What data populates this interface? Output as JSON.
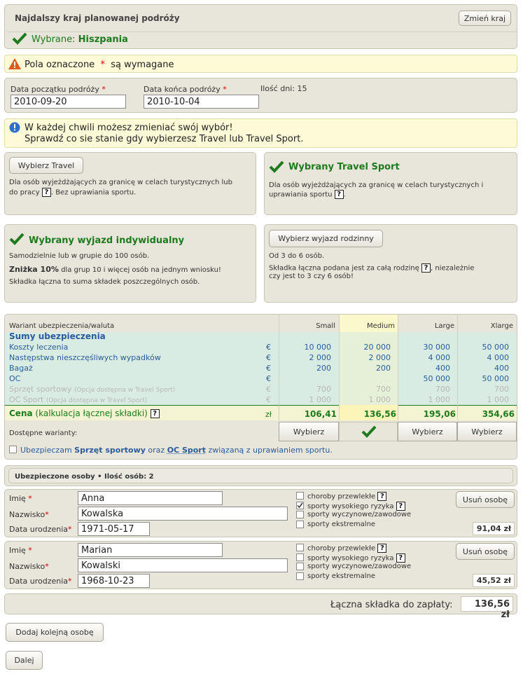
{
  "country": {
    "title": "Najdalszy kraj planowanej podróży",
    "change_button": "Zmień kraj",
    "selected_label": "Wybrane:",
    "selected_value": "Hiszpania"
  },
  "required_notice": {
    "before": "Pola oznaczone",
    "star": "*",
    "after": "są wymagane"
  },
  "dates": {
    "start_label": "Data początku podróży",
    "start_value": "2010-09-20",
    "end_label": "Data końca podróży",
    "end_value": "2010-10-04",
    "days": "Ilość dni: 15"
  },
  "info": {
    "line1": "W każdej chwili możesz zmieniać swój wybór!",
    "line2": "Sprawdź co sie stanie gdy wybierzesz Travel lub Travel Sport."
  },
  "product_travel": {
    "button": "Wybierz Travel",
    "desc1": "Dla osób wyjeżdżających za granicę w celach turystycznych lub",
    "desc2a": "do pracy",
    "help": "?",
    "desc2b": ". Bez uprawiania sportu."
  },
  "product_sport": {
    "title": "Wybrany Travel Sport",
    "desc1": "Dla osób wyjeżdżających za granicę w celach turystycznych i",
    "desc2a": "uprawiania sportu",
    "help": "?",
    "desc2b": "."
  },
  "trip_individual": {
    "title": "Wybrany wyjazd indywidualny",
    "line1": "Samodzielnie lub w grupie do 100 osób.",
    "line2_bold": "Zniżka 10%",
    "line2_rest": "dla grup 10 i więcej osób na jednym wniosku!",
    "line3": "Składka łączna to suma składek poszczególnych osób."
  },
  "trip_family": {
    "button": "Wybierz wyjazd rodzinny",
    "line1": "Od 3 do 6 osób.",
    "line2a": "Składka łączna podana jest za całą rodzinę",
    "help": "?",
    "line2b": ", niezależnie",
    "line3": "czy jest to 3 czy 6 osób!"
  },
  "variants": {
    "header_label": "Wariant ubezpieczenia/waluta",
    "columns": [
      "Small",
      "Medium",
      "Large",
      "Xlarge"
    ],
    "sums_title": "Sumy ubezpieczenia",
    "rows": [
      {
        "label": "Koszty leczenia",
        "note": "",
        "currency": "€",
        "values": [
          "10 000",
          "20 000",
          "30 000",
          "50 000"
        ],
        "style": "blue"
      },
      {
        "label": "Następstwa nieszczęśliwych wypadków",
        "note": "",
        "currency": "€",
        "values": [
          "2 000",
          "2 000",
          "4 000",
          "4 000"
        ],
        "style": "blue"
      },
      {
        "label": "Bagaż",
        "note": "",
        "currency": "€",
        "values": [
          "200",
          "200",
          "400",
          "400"
        ],
        "style": "blue"
      },
      {
        "label": "OC",
        "note": "",
        "currency": "€",
        "values": [
          "",
          "",
          "50 000",
          "50 000"
        ],
        "style": "blue"
      },
      {
        "label": "Sprzęt sportowy",
        "note": "(Opcja dostępna w Travel Sport)",
        "currency": "€",
        "values": [
          "700",
          "700",
          "700",
          "700"
        ],
        "style": "gray"
      },
      {
        "label": "OC Sport",
        "note": "(Opcja dostępna w Travel Sport)",
        "currency": "€",
        "values": [
          "1 000",
          "1 000",
          "1 000",
          "1 000"
        ],
        "style": "gray"
      }
    ],
    "price_label": "Cena",
    "price_note": "(kalkulacja łącznej składki)",
    "price_help": "?",
    "price_currency": "zł",
    "prices": [
      "106,41",
      "136,56",
      "195,06",
      "354,66"
    ],
    "available_label": "Dostępne warianty:",
    "choose_labels": [
      "Wybierz",
      "",
      "Wybierz",
      "Wybierz"
    ],
    "selected_index": 1,
    "sport_option": {
      "a": "Ubezpieczam",
      "b": "Sprzęt sportowy",
      "c": "oraz",
      "d": "OC Sport",
      "e": "związaną z uprawianiem sportu."
    }
  },
  "persons": {
    "header": "Ubezpieczone osoby • Ilość osób: 2",
    "first_name_label": "Imię",
    "last_name_label": "Nazwisko",
    "birth_label": "Data urodzenia",
    "remove_label": "Usuń osobę",
    "options": [
      "choroby przewlekłe",
      "sporty wysokiego ryzyka",
      "sporty wyczynowe/zawodowe",
      "sporty ekstremalne"
    ],
    "help": "?",
    "list": [
      {
        "first": "Anna",
        "last": "Kowalska",
        "birth": "1971-05-17",
        "checked": [
          false,
          true,
          false,
          false
        ],
        "premium": "91,04 zł"
      },
      {
        "first": "Marian",
        "last": "Kowalski",
        "birth": "1968-10-23",
        "checked": [
          false,
          false,
          false,
          false
        ],
        "premium": "45,52 zł"
      }
    ]
  },
  "total": {
    "label": "Łączna składka do zapłaty:",
    "value": "136,56 zł"
  },
  "add_person": "Dodaj kolejną osobę",
  "next": "Dalej",
  "colors": {
    "green": "#1e7a1e",
    "blue": "#2a5c9a",
    "panel": "#e8e5da",
    "teal": "#d8ece4",
    "yellow": "#fbf8cc"
  }
}
